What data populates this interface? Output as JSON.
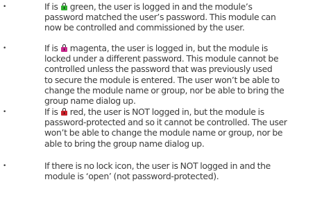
{
  "items": [
    {
      "bullet": "•",
      "lock_color": "#2fae2f",
      "lock_icon": "padlock-green-icon",
      "lines": [
        [
          "If is ",
          " green, the user is logged in and the module’s"
        ],
        [
          "password matched the user’s password. This module can"
        ],
        [
          "now be controlled and commissioned by the user."
        ]
      ]
    },
    {
      "bullet": "•",
      "lock_color": "#c8288c",
      "lock_icon": "padlock-magenta-icon",
      "lines": [
        [
          " If is ",
          " magenta, the user is logged in, but the module is"
        ],
        [
          "locked under a different password. This module cannot be"
        ],
        [
          "controlled unless the password that was previously used"
        ],
        [
          "to secure the module is entered. The user won’t be able to"
        ],
        [
          "change the module name or group, nor be able to bring the"
        ],
        [
          "group name dialog up."
        ]
      ]
    },
    {
      "bullet": "•",
      "lock_color": "#c8202a",
      "lock_icon": "padlock-red-icon",
      "lines": [
        [
          "If is ",
          " red, the user is NOT logged in, but the module is"
        ],
        [
          "password-protected and so it cannot be controlled. The user"
        ],
        [
          "won’t be able to change the module name or group, nor be"
        ],
        [
          "able to bring the group name dialog up."
        ]
      ]
    },
    {
      "bullet": "•",
      "lines": [
        [
          "If there is no lock icon, the user is NOT logged in and the"
        ],
        [
          "module is ‘open’ (not password-protected)."
        ]
      ]
    }
  ]
}
